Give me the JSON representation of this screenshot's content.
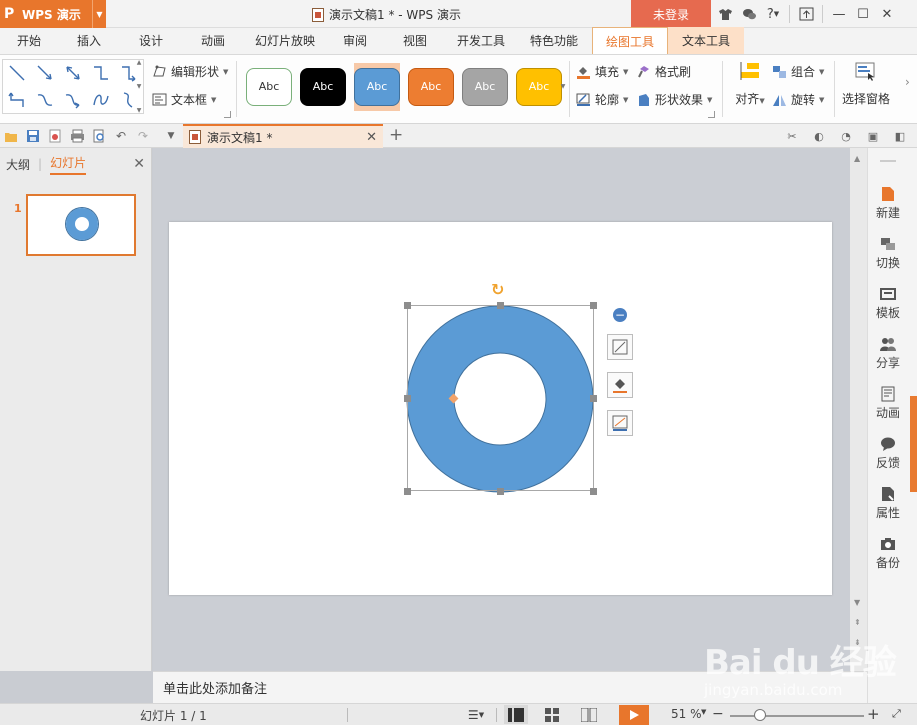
{
  "app": {
    "logo": "P",
    "name": "WPS 演示",
    "window_title": "演示文稿1 * - WPS 演示",
    "login_label": "未登录",
    "colors": {
      "accent": "#e8762c",
      "login_bg": "#e66a4f",
      "shape_fill": "#5b9bd5"
    }
  },
  "window_controls": {
    "skin_icon": "tshirt-icon",
    "chat_icon": "chat-icon",
    "help_label": "?",
    "restore_icon": "upload-box-icon",
    "minimize_label": "—",
    "maximize_label": "☐",
    "close_label": "✕"
  },
  "ribbon_tabs": [
    {
      "label": "开始"
    },
    {
      "label": "插入"
    },
    {
      "label": "设计"
    },
    {
      "label": "动画"
    },
    {
      "label": "幻灯片放映"
    },
    {
      "label": "审阅"
    },
    {
      "label": "视图"
    },
    {
      "label": "开发工具"
    },
    {
      "label": "特色功能"
    },
    {
      "label": "绘图工具"
    },
    {
      "label": "文本工具"
    }
  ],
  "ribbon": {
    "edit_shape": "编辑形状",
    "text_box": "文本框",
    "style_label": "Abc",
    "fill": "填充",
    "format_painter": "格式刷",
    "outline": "轮廓",
    "shape_effects": "形状效果",
    "align": "对齐",
    "group": "组合",
    "rotate": "旋转",
    "selection_pane": "选择窗格"
  },
  "document_tab": {
    "label": "演示文稿1 *"
  },
  "left_panel": {
    "tab_outline": "大纲",
    "tab_slides": "幻灯片",
    "slide_number": "1"
  },
  "right_sidebar": [
    {
      "label": "新建",
      "icon": "new-doc-icon"
    },
    {
      "label": "切换",
      "icon": "switch-icon"
    },
    {
      "label": "模板",
      "icon": "template-icon"
    },
    {
      "label": "分享",
      "icon": "share-people-icon"
    },
    {
      "label": "动画",
      "icon": "animation-icon"
    },
    {
      "label": "反馈",
      "icon": "feedback-icon"
    },
    {
      "label": "属性",
      "icon": "properties-icon"
    },
    {
      "label": "备份",
      "icon": "backup-camera-icon"
    }
  ],
  "notes": {
    "placeholder": "单击此处添加备注"
  },
  "status": {
    "slide_info": "幻灯片 1 / 1",
    "zoom": "51 %",
    "minus": "−",
    "plus": "+"
  },
  "watermark": {
    "brand": "Bai du 经验",
    "url": "jingyan.baidu.com"
  }
}
